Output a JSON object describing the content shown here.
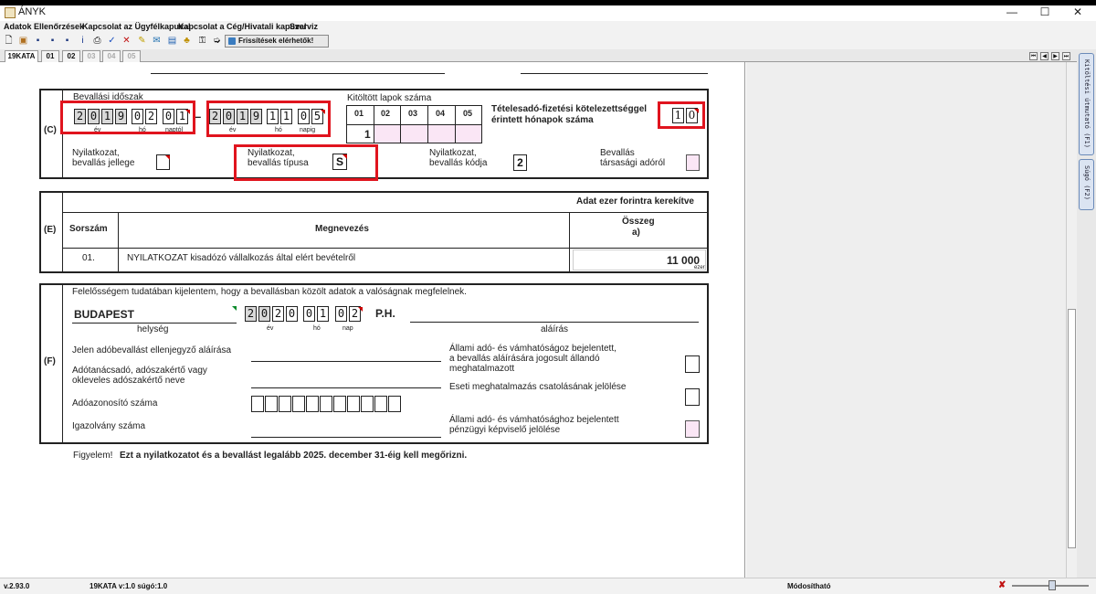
{
  "window": {
    "title": "ÁNYK",
    "minimize": "—",
    "maximize": "☐",
    "close": "✕"
  },
  "menu": [
    "Adatok",
    "Ellenőrzések",
    "Kapcsolat az Ügyfélkapuval",
    "Kapcsolat a Cég/Hivatali kapuval",
    "Szerviz"
  ],
  "toolbar": {
    "update_button": "Frissítések elérhetők!"
  },
  "tabs": [
    "19KATA",
    "01",
    "02",
    "03",
    "04",
    "05"
  ],
  "side_tabs": {
    "guide": "Kitöltési útmutató (F1)",
    "help": "Súgó (F2)"
  },
  "section_c": {
    "code": "(C)",
    "period_label": "Bevallási időszak",
    "start_date": {
      "year": "2019",
      "month": "02",
      "day": "01",
      "year_label": "év",
      "month_label": "hó",
      "day_label": "naptól"
    },
    "separator": "–",
    "end_date": {
      "year": "2019",
      "month": "11",
      "day": "05",
      "year_label": "év",
      "month_label": "hó",
      "day_label": "napig"
    },
    "pages_label": "Kitöltött lapok száma",
    "page_headers": [
      "01",
      "02",
      "03",
      "04",
      "05"
    ],
    "page_values": [
      "1",
      "",
      "",
      "",
      ""
    ],
    "months_label_1": "Tételesadó-fizetési kötelezettséggel",
    "months_label_2": "érintett hónapok száma",
    "months_value": [
      "1",
      "0"
    ],
    "nature_label_1": "Nyilatkozat,",
    "nature_label_2": "bevallás jellege",
    "nature_value": "",
    "type_label_1": "Nyilatkozat,",
    "type_label_2": "bevallás típusa",
    "type_value": "S",
    "code_label_1": "Nyilatkozat,",
    "code_label_2": "bevallás kódja",
    "code_value": "2",
    "corp_label_1": "Bevallás",
    "corp_label_2": "társasági adóról"
  },
  "section_e": {
    "code": "(E)",
    "note": "Adat ezer forintra kerekítve",
    "col_no": "Sorszám",
    "col_name": "Megnevezés",
    "col_amount_1": "Összeg",
    "col_amount_2": "a)",
    "rows": [
      {
        "no": "01.",
        "name": "NYILATKOZAT kisadózó vállalkozás által elért bevételről",
        "amount": "11 000",
        "unit": "ezer"
      }
    ]
  },
  "section_f": {
    "code": "(F)",
    "statement": "Felelősségem tudatában kijelentem, hogy a bevallásban közölt adatok a valóságnak megfelelnek.",
    "place": "BUDAPEST",
    "place_label": "helység",
    "sign_date": {
      "year": "2020",
      "month": "01",
      "day": "02",
      "year_label": "év",
      "month_label": "hó",
      "day_label": "nap"
    },
    "ph": "P.H.",
    "signature_label": "aláírás",
    "countersign_label": "Jelen adóbevallást ellenjegyző aláírása",
    "advisor_label_1": "Adótanácsadó,  adószakértő vagy",
    "advisor_label_2": "okleveles adószakértő neve",
    "taxid_label": "Adóazonosító száma",
    "id_label": "Igazolvány száma",
    "perm_auth_1": "Állami adó- és vámhatóságoz bejelentett,",
    "perm_auth_2": "a bevallás aláírására jogosult állandó",
    "perm_auth_3": "meghatalmazott",
    "occasional_auth": "Eseti meghatalmazás csatolásának jelölése",
    "fin_rep_1": "Állami adó- és vámhatósághoz bejelentett",
    "fin_rep_2": "pénzügyi képviselő jelölése"
  },
  "warning": {
    "prefix": "Figyelem!",
    "text": "Ezt a nyilatkozatot és a bevallást legalább 2025. december 31-éig kell megőrizni."
  },
  "status": {
    "version": "v.2.93.0",
    "form": "19KATA v:1.0 súgó:1.0",
    "mode": "Módosítható"
  }
}
